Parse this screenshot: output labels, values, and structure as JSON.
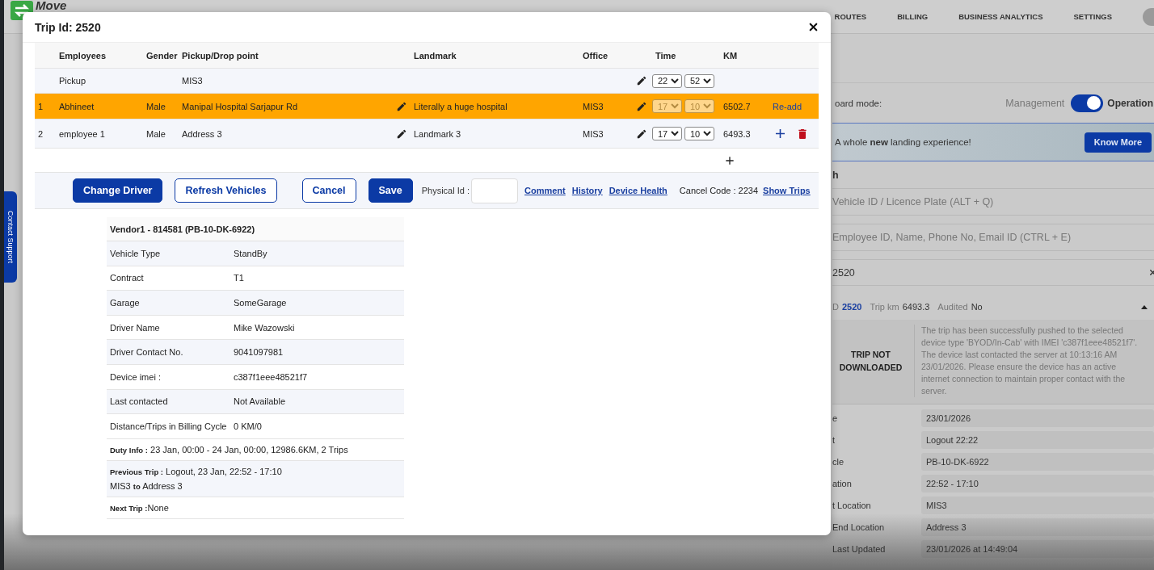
{
  "header": {
    "logo": "Move",
    "nav": [
      {
        "label": "ROUTES",
        "selected": false
      },
      {
        "label": "BILLING",
        "selected": false
      },
      {
        "label": "BUSINESS ANALYTICS",
        "selected": false
      },
      {
        "label": "SETTINGS",
        "selected": false
      }
    ]
  },
  "contact_support": "Contact Support",
  "panel": {
    "mode_label": "oard mode:",
    "mode_left": "Management",
    "mode_on": true,
    "mode_right": "Operation",
    "banner": {
      "text": "A whole **new** landing experience!",
      "button": "Know More"
    },
    "heading": "h",
    "search_fields": [
      {
        "placeholder": "Vehicle ID / Licence Plate (ALT + Q)"
      },
      {
        "placeholder": "Employee ID, Name, Phone No, Email ID (CTRL + E)"
      }
    ],
    "search_value": "2520",
    "trip_summary": {
      "prefix": "D",
      "id": "2520",
      "km_label": "Trip km",
      "km": "6493.3",
      "audited_label": "Audited",
      "audited": "No",
      "expanded": true
    },
    "status": {
      "title": "TRIP NOT DOWNLOADED",
      "message": "The trip has been successfully pushed to the selected device type 'BYOD/In-Cab' with IMEI 'c387f1eee48521f7'. The device last contacted the server at 10:13:16 AM 23/01/2026. Please ensure the device has an active internet connection to maintain proper contact with the server."
    },
    "details": [
      {
        "label": "e",
        "value": "23/01/2026"
      },
      {
        "label": "t",
        "value": "Logout 22:22"
      },
      {
        "label": "cle",
        "value": "PB-10-DK-6922"
      },
      {
        "label": "ation",
        "value": "22:52 - 17:10"
      },
      {
        "label": "t Location",
        "value": "MIS3"
      },
      {
        "label": "End Location",
        "value": "Address 3"
      },
      {
        "label": "Last Updated",
        "value": "23/01/2026 at 14:49:04"
      }
    ]
  },
  "modal": {
    "title": "Trip Id: 2520",
    "columns": [
      "Employees",
      "Gender",
      "Pickup/Drop point",
      "Landmark",
      "Office",
      "Time",
      "KM"
    ],
    "rows": [
      {
        "kind": "pickup",
        "name": "Pickup",
        "point": "MIS3",
        "hour": "22",
        "minute": "52"
      },
      {
        "kind": "employee",
        "index": "1",
        "name": "Abhineet",
        "gender": "Male",
        "point": "Manipal Hospital Sarjapur Rd",
        "landmark": "Literally a huge hospital",
        "office": "MIS3",
        "hour": "17",
        "minute": "10",
        "km": "6502.7",
        "selected": true,
        "disabled": true,
        "action": "Re-add"
      },
      {
        "kind": "employee",
        "index": "2",
        "name": "employee 1",
        "gender": "Male",
        "point": "Address 3",
        "landmark": "Landmark 3",
        "office": "MIS3",
        "hour": "17",
        "minute": "10",
        "km": "6493.3",
        "selected": false,
        "disabled": false
      }
    ],
    "buttons": [
      {
        "label": "Change Driver",
        "kind": "primary"
      },
      {
        "label": "Refresh Vehicles",
        "kind": "outline"
      },
      {
        "label": "Cancel",
        "kind": "outline"
      },
      {
        "label": "Save",
        "kind": "primary"
      }
    ],
    "physical_id_label": "Physical Id :",
    "links": [
      "Comment",
      "History",
      "Device Health"
    ],
    "cancel_code": "Cancel Code : 2234",
    "show_trips": "Show Trips",
    "vendor": {
      "title": "Vendor1 - 814581 (PB-10-DK-6922)",
      "rows": [
        {
          "label": "Vehicle Type",
          "value": "StandBy"
        },
        {
          "label": "Contract",
          "value": "T1"
        },
        {
          "label": "Garage",
          "value": "SomeGarage"
        },
        {
          "label": "Driver Name",
          "value": "Mike Wazowski"
        },
        {
          "label": "Driver Contact No.",
          "value": "9041097981"
        },
        {
          "label": "Device imei :",
          "value": "c387f1eee48521f7"
        },
        {
          "label": "Last contacted",
          "value": "Not Available"
        },
        {
          "label": "Distance/Trips in Billing Cycle",
          "value": "0 KM/0"
        }
      ],
      "notes": [
        {
          "lines": [
            "**Duty Info :** 23 Jan, 00:00 - 24 Jan, 00:00, 12986.6KM, 2 Trips"
          ]
        },
        {
          "lines": [
            "**Previous Trip :** Logout, 23 Jan, 22:52 - 17:10",
            "MIS3 **to** Address 3"
          ]
        },
        {
          "lines": [
            "**Next Trip :**None"
          ]
        }
      ]
    }
  }
}
